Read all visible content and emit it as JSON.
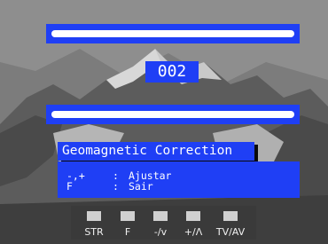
{
  "osd": {
    "channel_number": "002",
    "top_bar_level": 1.0,
    "bottom_bar_level": 1.0,
    "title": "Geomagnetic Correction",
    "help": [
      {
        "key": "-,+",
        "separator": ":",
        "action": "Ajustar"
      },
      {
        "key": "F",
        "separator": ":",
        "action": "Sair"
      }
    ]
  },
  "keys": [
    {
      "label": "STR"
    },
    {
      "label": "F"
    },
    {
      "label": "-/v"
    },
    {
      "label": "+/Λ"
    },
    {
      "label": "TV/AV"
    }
  ],
  "colors": {
    "osd_blue": "#1f3ff5",
    "bar_white": "#ffffff",
    "key_bar": "#3a3a3a",
    "key_button": "#d0d0d0"
  }
}
